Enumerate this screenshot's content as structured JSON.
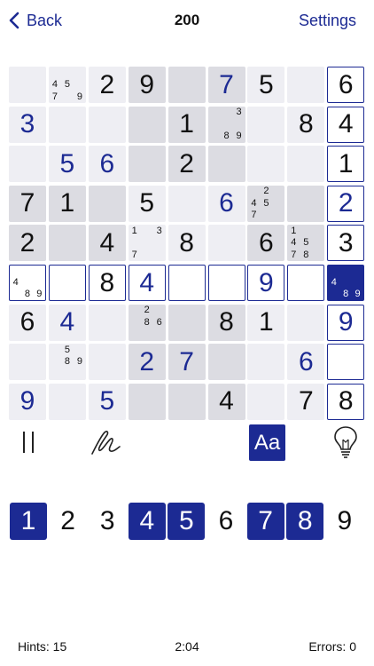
{
  "nav": {
    "back_label": "Back",
    "title": "200",
    "settings_label": "Settings"
  },
  "colors": {
    "accent": "#1c2a93",
    "cell_light": "#eeeef3",
    "cell_dark": "#dcdce2",
    "highlight": "#cfcfe0"
  },
  "board": [
    [
      {
        "v": ""
      },
      {
        "n": [
          "",
          "",
          "",
          "4",
          "5",
          "",
          "7",
          "",
          "9"
        ]
      },
      {
        "v": "2"
      },
      {
        "v": "9"
      },
      {
        "v": ""
      },
      {
        "v": "7",
        "u": true
      },
      {
        "v": "5"
      },
      {
        "v": ""
      },
      {
        "v": "6"
      }
    ],
    [
      {
        "v": "3",
        "u": true
      },
      {
        "v": ""
      },
      {
        "v": ""
      },
      {
        "v": ""
      },
      {
        "v": "1"
      },
      {
        "n": [
          "",
          "",
          "3",
          "",
          "",
          "",
          "",
          "8",
          "9"
        ]
      },
      {
        "v": ""
      },
      {
        "v": "8"
      },
      {
        "v": "4"
      }
    ],
    [
      {
        "v": ""
      },
      {
        "v": "5",
        "u": true
      },
      {
        "v": "6",
        "u": true
      },
      {
        "v": ""
      },
      {
        "v": "2"
      },
      {
        "v": ""
      },
      {
        "v": ""
      },
      {
        "v": ""
      },
      {
        "v": "1"
      }
    ],
    [
      {
        "v": "7"
      },
      {
        "v": "1"
      },
      {
        "v": ""
      },
      {
        "v": "5"
      },
      {
        "v": ""
      },
      {
        "v": "6",
        "u": true
      },
      {
        "n": [
          "",
          "2",
          "",
          "4",
          "5",
          "",
          "7",
          "",
          ""
        ]
      },
      {
        "v": ""
      },
      {
        "v": "2",
        "u": true
      }
    ],
    [
      {
        "v": "2"
      },
      {
        "v": ""
      },
      {
        "v": "4"
      },
      {
        "n": [
          "1",
          "",
          "3",
          "",
          "",
          "",
          "7",
          "",
          ""
        ]
      },
      {
        "v": "8"
      },
      {
        "v": ""
      },
      {
        "v": "6"
      },
      {
        "n": [
          "1",
          "",
          "",
          "4",
          "5",
          "",
          "7",
          "8",
          ""
        ]
      },
      {
        "v": "3"
      }
    ],
    [
      {
        "n": [
          "",
          "",
          "",
          "4",
          "",
          "",
          "",
          "8",
          "9"
        ]
      },
      {
        "v": ""
      },
      {
        "v": "8"
      },
      {
        "v": "4",
        "u": true
      },
      {
        "v": ""
      },
      {
        "v": ""
      },
      {
        "v": "9",
        "u": true
      },
      {
        "v": ""
      },
      {
        "n": [
          "",
          "",
          "",
          "4",
          "",
          "",
          "",
          "8",
          "9"
        ]
      }
    ],
    [
      {
        "v": "6"
      },
      {
        "v": "4",
        "u": true
      },
      {
        "v": ""
      },
      {
        "n": [
          "",
          "2",
          "",
          "",
          "8",
          "6",
          "",
          "",
          ""
        ]
      },
      {
        "v": ""
      },
      {
        "v": "8"
      },
      {
        "v": "1"
      },
      {
        "v": ""
      },
      {
        "v": "9",
        "u": true
      }
    ],
    [
      {
        "v": ""
      },
      {
        "n": [
          "",
          "5",
          "",
          "",
          "8",
          "9",
          "",
          "",
          ""
        ]
      },
      {
        "v": ""
      },
      {
        "v": "2",
        "u": true
      },
      {
        "v": "7",
        "u": true
      },
      {
        "v": ""
      },
      {
        "v": ""
      },
      {
        "v": "6",
        "u": true
      },
      {
        "v": ""
      }
    ],
    [
      {
        "v": "9",
        "u": true
      },
      {
        "v": ""
      },
      {
        "v": "5",
        "u": true
      },
      {
        "v": ""
      },
      {
        "v": ""
      },
      {
        "v": "4"
      },
      {
        "v": ""
      },
      {
        "v": "7"
      },
      {
        "v": "8"
      }
    ]
  ],
  "selected_cell": {
    "row": 5,
    "col": 8
  },
  "toolbar": {
    "pause_icon": "pause-icon",
    "pencil_icon": "pencil-icon",
    "notes_label": "Aa",
    "hint_icon": "lightbulb-icon"
  },
  "numpad": [
    {
      "label": "1",
      "active": true
    },
    {
      "label": "2",
      "active": false
    },
    {
      "label": "3",
      "active": false
    },
    {
      "label": "4",
      "active": true
    },
    {
      "label": "5",
      "active": true
    },
    {
      "label": "6",
      "active": false
    },
    {
      "label": "7",
      "active": true
    },
    {
      "label": "8",
      "active": true
    },
    {
      "label": "9",
      "active": false
    }
  ],
  "footer": {
    "hints": "Hints: 15",
    "time": "2:04",
    "errors": "Errors: 0"
  }
}
